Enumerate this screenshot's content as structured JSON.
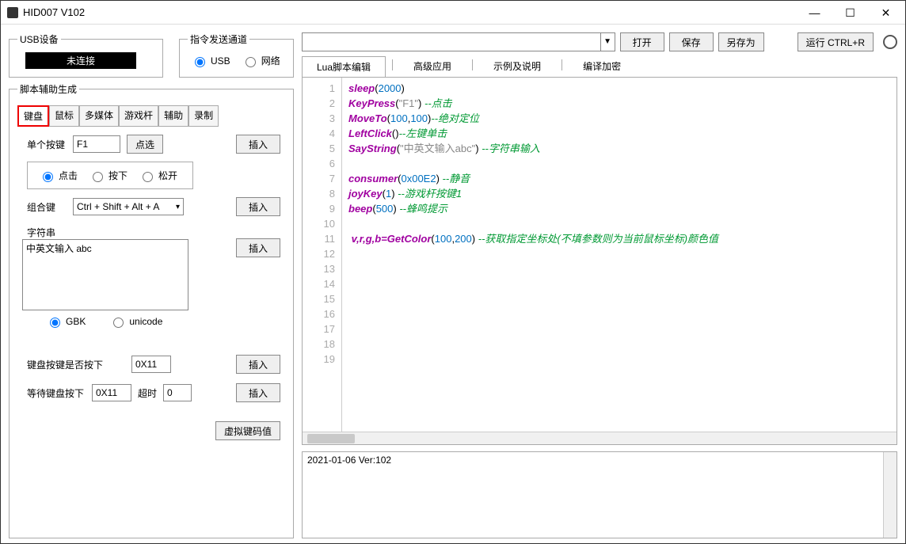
{
  "window": {
    "title": "HID007  V102"
  },
  "usb": {
    "legend": "USB设备",
    "status": "未连接"
  },
  "channel": {
    "legend": "指令发送通道",
    "usb": "USB",
    "net": "网络"
  },
  "script": {
    "legend": "脚本辅助生成",
    "tabs": [
      "键盘",
      "鼠标",
      "多媒体",
      "游戏杆",
      "辅助",
      "录制"
    ],
    "singleKeyLabel": "单个按键",
    "singleKeyValue": "F1",
    "select": "点选",
    "insert": "插入",
    "action": {
      "click": "点击",
      "down": "按下",
      "up": "松开"
    },
    "comboLabel": "组合键",
    "comboValue": "Ctrl + Shift + Alt + A",
    "strLabel": "字符串",
    "strValue": "中英文输入 abc",
    "enc": {
      "gbk": "GBK",
      "uni": "unicode"
    },
    "isDownLabel": "键盘按键是否按下",
    "isDownValue": "0X11",
    "waitLabel": "等待键盘按下",
    "waitValue": "0X11",
    "timeoutLabel": "超时",
    "timeoutValue": "0",
    "vkBtn": "虚拟键码值"
  },
  "toolbar": {
    "open": "打开",
    "save": "保存",
    "saveas": "另存为",
    "run": "运行 CTRL+R"
  },
  "editorTabs": [
    "Lua脚本编辑",
    "高级应用",
    "示例及说明",
    "编译加密"
  ],
  "code": {
    "lines": [
      {
        "n": 1,
        "html": "<span class='kw'>sleep</span>(<span class='num'>2000</span>)"
      },
      {
        "n": 2,
        "html": "<span class='kw'>KeyPress</span>(<span class='str'>\"F1\"</span>) <span class='cm'>--点击</span>"
      },
      {
        "n": 3,
        "html": "<span class='kw'>MoveTo</span>(<span class='num'>100</span>,<span class='num'>100</span>)<span class='cm'>--绝对定位</span>"
      },
      {
        "n": 4,
        "html": "<span class='kw'>LeftClick</span>()<span class='cm'>--左键单击</span>"
      },
      {
        "n": 5,
        "html": "<span class='kw'>SayString</span>(<span class='str'>\"中英文输入abc\"</span>) <span class='cm'>--字符串输入</span>"
      },
      {
        "n": 6,
        "html": ""
      },
      {
        "n": 7,
        "html": "<span class='kw'>consumer</span>(<span class='num'>0x00E2</span>) <span class='cm'>--静音</span>"
      },
      {
        "n": 8,
        "html": "<span class='kw'>joyKey</span>(<span class='num'>1</span>) <span class='cm'>--游戏杆按键1</span>"
      },
      {
        "n": 9,
        "html": "<span class='kw'>beep</span>(<span class='num'>500</span>) <span class='cm'>--蜂鸣提示</span>"
      },
      {
        "n": 10,
        "html": ""
      },
      {
        "n": 11,
        "html": " <span class='kw'>v,r,g,b=GetColor</span>(<span class='num'>100</span>,<span class='num'>200</span>) <span class='cm'>--获取指定坐标处(不填参数则为当前鼠标坐标)颜色值</span>"
      },
      {
        "n": 12,
        "html": ""
      },
      {
        "n": 13,
        "html": ""
      },
      {
        "n": 14,
        "html": ""
      },
      {
        "n": 15,
        "html": ""
      },
      {
        "n": 16,
        "html": ""
      },
      {
        "n": 17,
        "html": ""
      },
      {
        "n": 18,
        "html": ""
      },
      {
        "n": 19,
        "html": ""
      }
    ]
  },
  "log": "2021-01-06 Ver:102"
}
